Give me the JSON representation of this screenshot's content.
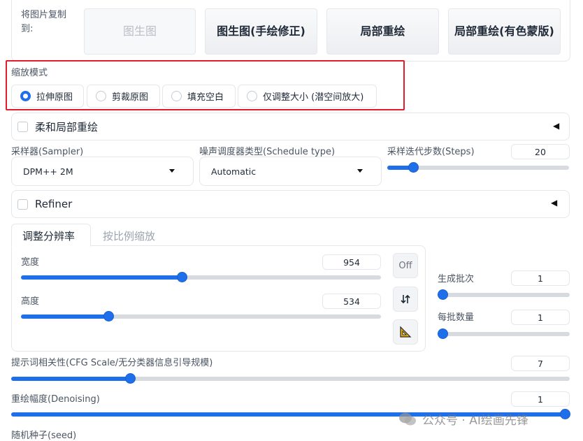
{
  "copy_to": {
    "label": "将图片复制到:",
    "buttons": [
      "图生图",
      "图生图(手绘修正)",
      "局部重绘",
      "局部重绘(有色蒙版)"
    ]
  },
  "resize_mode": {
    "label": "缩放模式",
    "options": [
      "拉伸原图",
      "剪裁原图",
      "填充空白",
      "仅调整大小 (潜空间放大)"
    ],
    "selected": "拉伸原图"
  },
  "soft_inpainting": {
    "label": "柔和局部重绘",
    "checked": false
  },
  "sampler": {
    "label": "采样器(Sampler)",
    "value": "DPM++ 2M"
  },
  "schedule": {
    "label": "噪声调度器类型(Schedule type)",
    "value": "Automatic"
  },
  "steps": {
    "label": "采样迭代步数(Steps)",
    "value": "20",
    "fraction": 0.14
  },
  "refiner": {
    "label": "Refiner",
    "checked": false
  },
  "tabs": [
    "调整分辨率",
    "按比例缩放"
  ],
  "width": {
    "label": "宽度",
    "value": "954",
    "fraction": 0.454
  },
  "height": {
    "label": "高度",
    "value": "534",
    "fraction": 0.247
  },
  "side_buttons": {
    "off": "Off"
  },
  "batch_count": {
    "label": "生成批次",
    "value": "1",
    "fraction": 0.0
  },
  "batch_size": {
    "label": "每批数量",
    "value": "1",
    "fraction": 0.0
  },
  "cfg": {
    "label": "提示词相关性(CFG Scale/无分类器信息引导规模)",
    "value": "7",
    "fraction": 0.212
  },
  "denoise": {
    "label": "重绘幅度(Denoising)",
    "value": "1",
    "fraction": 1.0
  },
  "seed": {
    "label": "随机种子(seed)"
  },
  "watermark": "公众号 · AI绘画先锋",
  "colors": {
    "accent": "#1f6feb",
    "highlight": "#e11d2a"
  }
}
